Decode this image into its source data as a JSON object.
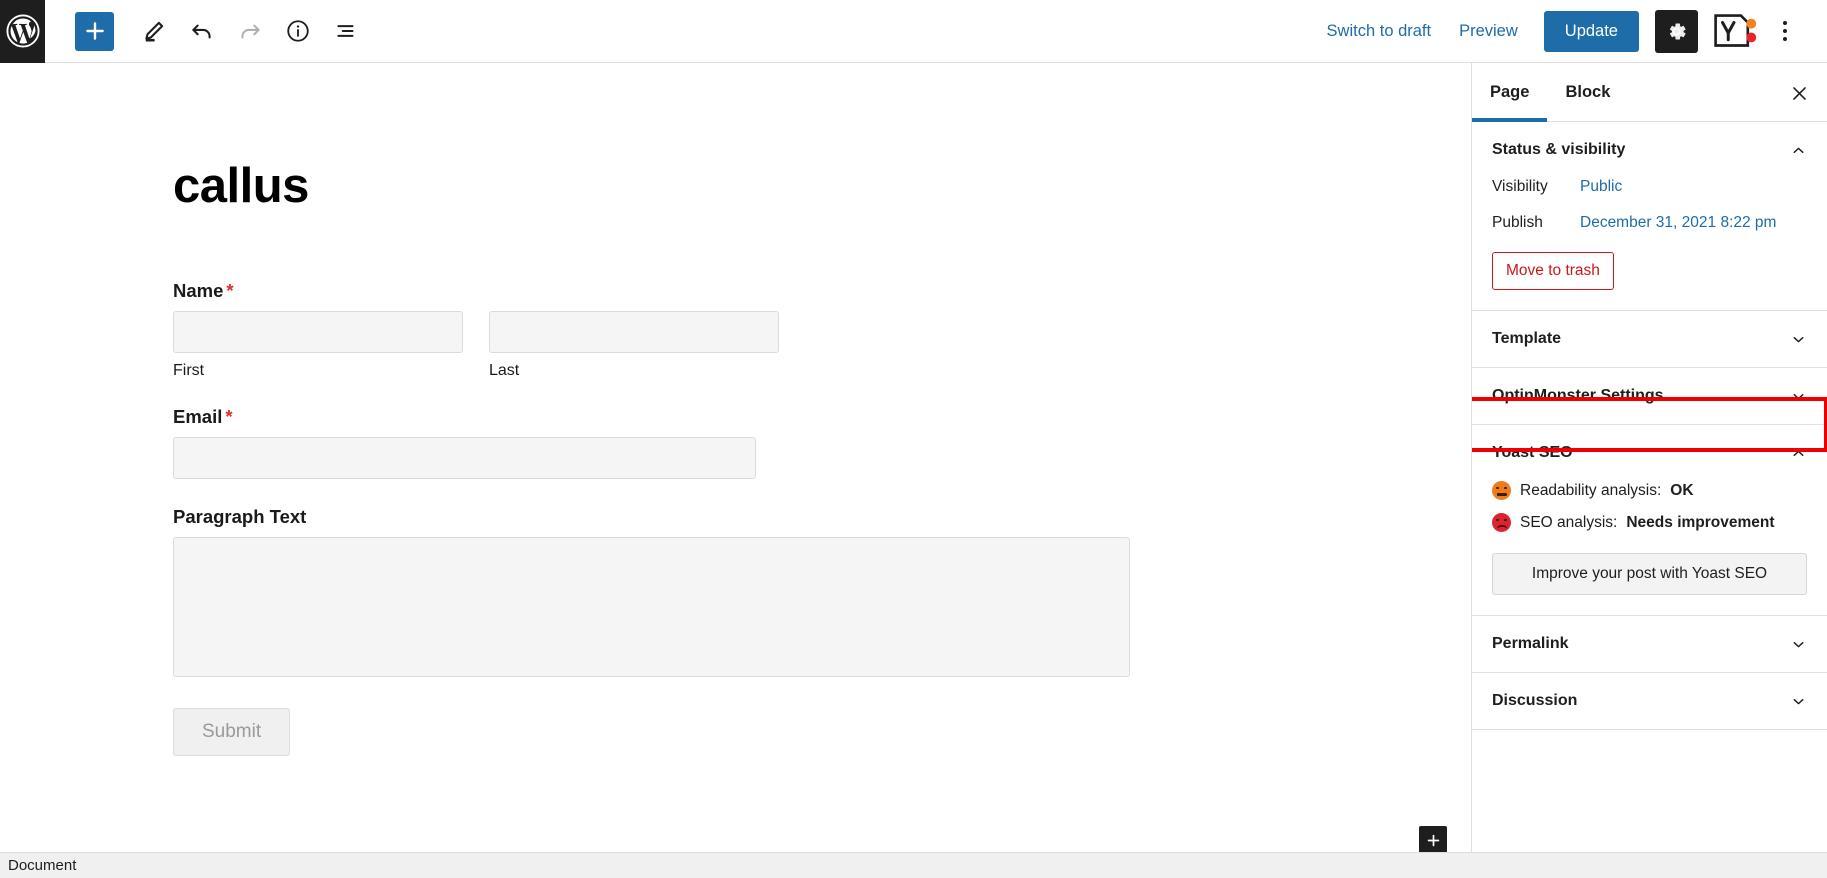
{
  "topbar": {
    "logo_icon": "wordpress-logo-icon",
    "tools": [
      {
        "name": "block-inserter",
        "icon": "plus-icon",
        "label": "Toggle block inserter"
      },
      {
        "name": "tools-edit",
        "icon": "pencil-icon",
        "label": "Tools"
      },
      {
        "name": "undo",
        "icon": "undo-arrow-icon",
        "label": "Undo"
      },
      {
        "name": "redo",
        "icon": "redo-arrow-icon",
        "label": "Redo"
      },
      {
        "name": "details",
        "icon": "info-circle-icon",
        "label": "Details"
      },
      {
        "name": "list-view",
        "icon": "list-view-icon",
        "label": "List view"
      }
    ],
    "switch_to_draft": "Switch to draft",
    "preview": "Preview",
    "update": "Update",
    "settings_icon": "gear-icon",
    "yoast_icon": "yoast-seo-icon",
    "more_icon": "kebab-menu-icon"
  },
  "editor": {
    "post_title": "callus",
    "form": {
      "name": {
        "label": "Name",
        "required_mark": "*",
        "first_value": "",
        "first_sublabel": "First",
        "last_value": "",
        "last_sublabel": "Last"
      },
      "email": {
        "label": "Email",
        "required_mark": "*",
        "value": ""
      },
      "paragraph": {
        "label": "Paragraph Text",
        "value": ""
      },
      "submit_label": "Submit"
    },
    "add_block_icon": "plus-icon"
  },
  "sidebar": {
    "tabs": [
      {
        "label": "Page",
        "active": true
      },
      {
        "label": "Block",
        "active": false
      }
    ],
    "close_icon": "close-icon",
    "panels": [
      {
        "title": "Status & visibility",
        "expanded": true,
        "rows": [
          {
            "key": "Visibility",
            "value": "Public"
          },
          {
            "key": "Publish",
            "value": "December 31, 2021 8:22 pm"
          }
        ],
        "trash_label": "Move to trash"
      },
      {
        "title": "Template",
        "expanded": false,
        "highlighted": true
      },
      {
        "title": "OptinMonster Settings",
        "expanded": false
      },
      {
        "title": "Yoast SEO",
        "expanded": true,
        "analyses": [
          {
            "prefix": "Readability analysis:",
            "value": "OK",
            "status": "ok"
          },
          {
            "prefix": "SEO analysis:",
            "value": "Needs improvement",
            "status": "bad"
          }
        ],
        "cta_label": "Improve your post with Yoast SEO"
      },
      {
        "title": "Permalink",
        "expanded": false
      },
      {
        "title": "Discussion",
        "expanded": false
      }
    ]
  },
  "statusbar": {
    "text": "Document"
  },
  "colors": {
    "accent_blue": "#1e6ca8",
    "danger_red": "#cc1818",
    "highlight_red": "#ee0000",
    "readability_orange": "#ee7c1a",
    "seo_red": "#dc2430"
  }
}
